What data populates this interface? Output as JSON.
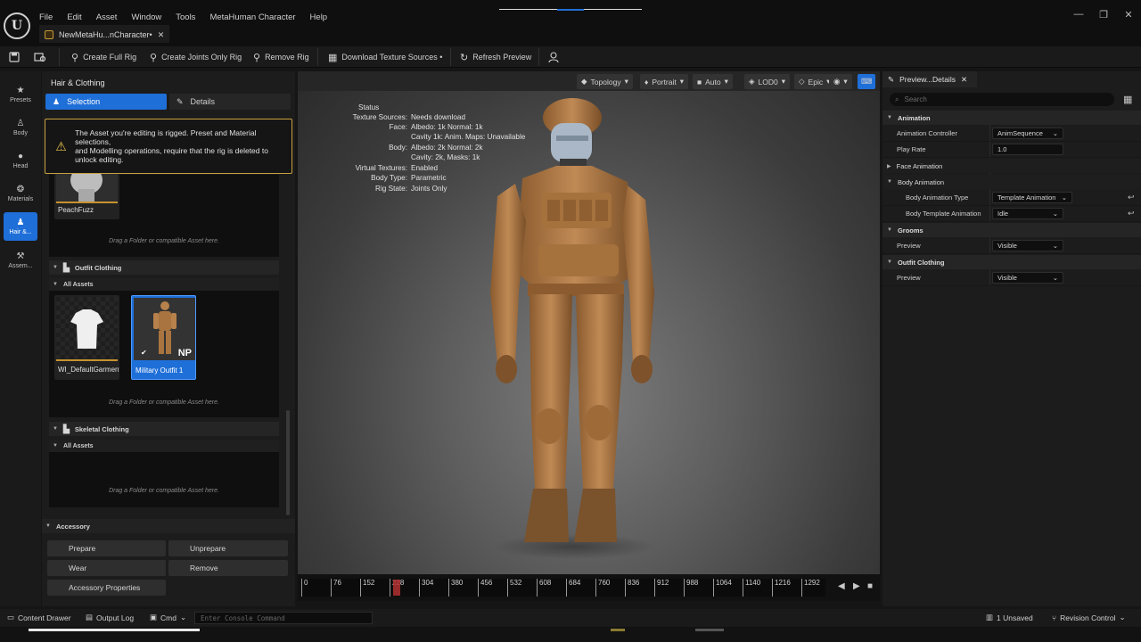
{
  "app": {
    "logo_letter": "U",
    "menu": [
      "File",
      "Edit",
      "Asset",
      "Window",
      "Tools",
      "MetaHuman Character",
      "Help"
    ],
    "document_tab": "NewMetaHu...nCharacter•"
  },
  "toolbar": {
    "create_full_rig": "Create Full Rig",
    "create_joints_only_rig": "Create Joints Only Rig",
    "remove_rig": "Remove Rig",
    "download_texture_sources": "Download Texture Sources •",
    "refresh_preview": "Refresh Preview"
  },
  "rail": {
    "items": [
      {
        "label": "Presets",
        "icon": "star-icon"
      },
      {
        "label": "Body",
        "icon": "body-icon"
      },
      {
        "label": "Head",
        "icon": "head-icon"
      },
      {
        "label": "Materials",
        "icon": "materials-icon"
      },
      {
        "label": "Hair &...",
        "icon": "hair-icon"
      },
      {
        "label": "Assem...",
        "icon": "hammer-icon"
      }
    ]
  },
  "left_panel": {
    "title": "Hair & Clothing",
    "selection_tab": "Selection",
    "details_tab": "Details",
    "warning_text": "The Asset you're editing is rigged. Preset and Material selections,\nand Modelling operations, require that the rig is deleted to unlock editing.",
    "peach_fuzz_label": "PeachFuzz",
    "drop_hint": "Drag a Folder or compatible Asset here.",
    "outfit_clothing": {
      "title": "Outfit Clothing",
      "all_assets": "All Assets",
      "assets": [
        "WI_DefaultGarment",
        "Military Outfit 1"
      ],
      "np_badge": "NP"
    },
    "skeletal_clothing": {
      "title": "Skeletal Clothing",
      "all_assets": "All Assets"
    },
    "accessory": {
      "title": "Accessory",
      "buttons": [
        "Prepare",
        "Unprepare",
        "Wear",
        "Remove",
        "Accessory Properties"
      ]
    }
  },
  "viewport": {
    "pills": [
      "Topology",
      "Portrait",
      "Auto",
      "LOD0",
      "Epic"
    ],
    "status_title": "Status",
    "status_rows": [
      {
        "key": "Texture Sources:",
        "value": "Needs download"
      },
      {
        "key": "Face:",
        "value": "Albedo: 1k Normal: 1k"
      },
      {
        "key": "",
        "value": "Cavity 1k: Anim. Maps: Unavailable"
      },
      {
        "key": "Body:",
        "value": "Albedo: 2k Normal: 2k"
      },
      {
        "key": "",
        "value": "Cavity: 2k, Masks: 1k"
      },
      {
        "key": "Virtual Textures:",
        "value": "Enabled"
      },
      {
        "key": "Body Type:",
        "value": "Parametric"
      },
      {
        "key": "Rig State:",
        "value": "Joints Only"
      }
    ]
  },
  "timeline": {
    "ticks": [
      "0",
      "76",
      "152",
      "228",
      "304",
      "380",
      "456",
      "532",
      "608",
      "684",
      "760",
      "836",
      "912",
      "988",
      "1064",
      "1140",
      "1216",
      "1292"
    ]
  },
  "details": {
    "tab": "Preview...Details",
    "search_placeholder": "Search",
    "categories": [
      {
        "title": "Animation",
        "rows": [
          {
            "name": "Animation Controller",
            "value": "AnimSequence",
            "dropdown": true
          },
          {
            "name": "Play Rate",
            "value": "1.0",
            "dropdown": false
          }
        ]
      },
      {
        "title": "Face Animation",
        "collapsed": true,
        "rows": []
      },
      {
        "title": "Body Animation",
        "rows": [
          {
            "name": "Body Animation Type",
            "value": "Template Animation",
            "dropdown": true
          },
          {
            "name": "Body Template Animation",
            "value": "Idle",
            "dropdown": true
          }
        ]
      },
      {
        "title": "Grooms",
        "rows": [
          {
            "name": "Preview",
            "value": "Visible",
            "dropdown": true
          }
        ]
      },
      {
        "title": "Outfit Clothing",
        "rows": [
          {
            "name": "Preview",
            "value": "Visible",
            "dropdown": true
          }
        ]
      }
    ]
  },
  "statusbar": {
    "content_drawer": "Content Drawer",
    "output_log": "Output Log",
    "cmd": "Cmd",
    "console_placeholder": "Enter Console Command",
    "unsaved": "1 Unsaved",
    "revision_control": "Revision Control"
  },
  "colors": {
    "accent": "#1f6fd8",
    "warning": "#e7c14d",
    "outfit_tan": "#b7814c"
  }
}
